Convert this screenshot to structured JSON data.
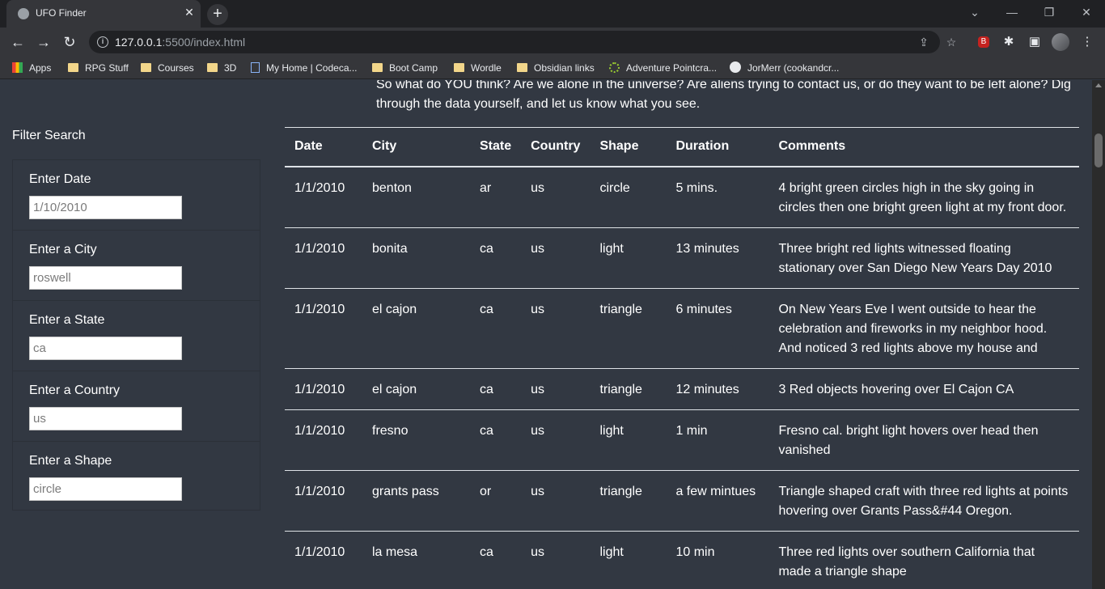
{
  "browser": {
    "tab_title": "UFO Finder",
    "url_host": "127.0.0.1",
    "url_rest": ":5500/index.html",
    "bookmarks": [
      "Apps",
      "RPG Stuff",
      "Courses",
      "3D",
      "My Home | Codeca...",
      "Boot Camp",
      "Wordle",
      "Obsidian links",
      "Adventure Pointcra...",
      "JorMerr (cookandcr..."
    ]
  },
  "intro": {
    "text": "So what do YOU think? Are we alone in the universe? Are aliens trying to contact us, or do they want to be left alone? Dig through the data yourself, and let us know what you see."
  },
  "filters": {
    "title": "Filter Search",
    "date": {
      "label": "Enter Date",
      "placeholder": "1/10/2010"
    },
    "city": {
      "label": "Enter a City",
      "placeholder": "roswell"
    },
    "state": {
      "label": "Enter a State",
      "placeholder": "ca"
    },
    "country": {
      "label": "Enter a Country",
      "placeholder": "us"
    },
    "shape": {
      "label": "Enter a Shape",
      "placeholder": "circle"
    }
  },
  "table": {
    "headers": [
      "Date",
      "City",
      "State",
      "Country",
      "Shape",
      "Duration",
      "Comments"
    ],
    "rows": [
      [
        "1/1/2010",
        "benton",
        "ar",
        "us",
        "circle",
        "5 mins.",
        "4 bright green circles high in the sky going in circles then one bright green light at my front door."
      ],
      [
        "1/1/2010",
        "bonita",
        "ca",
        "us",
        "light",
        "13 minutes",
        "Three bright red lights witnessed floating stationary over San Diego New Years Day 2010"
      ],
      [
        "1/1/2010",
        "el cajon",
        "ca",
        "us",
        "triangle",
        "6 minutes",
        "On New Years Eve I went outside to hear the celebration and fireworks in my neighbor hood. And noticed 3 red lights above my house and"
      ],
      [
        "1/1/2010",
        "el cajon",
        "ca",
        "us",
        "triangle",
        "12 minutes",
        "3 Red objects hovering over El Cajon CA"
      ],
      [
        "1/1/2010",
        "fresno",
        "ca",
        "us",
        "light",
        "1 min",
        "Fresno cal. bright light hovers over head then vanished"
      ],
      [
        "1/1/2010",
        "grants pass",
        "or",
        "us",
        "triangle",
        "a few mintues",
        "Triangle shaped craft with three red lights at points hovering over Grants Pass&#44 Oregon."
      ],
      [
        "1/1/2010",
        "la mesa",
        "ca",
        "us",
        "light",
        "10 min",
        "Three red lights over southern California that made a triangle shape"
      ]
    ]
  }
}
